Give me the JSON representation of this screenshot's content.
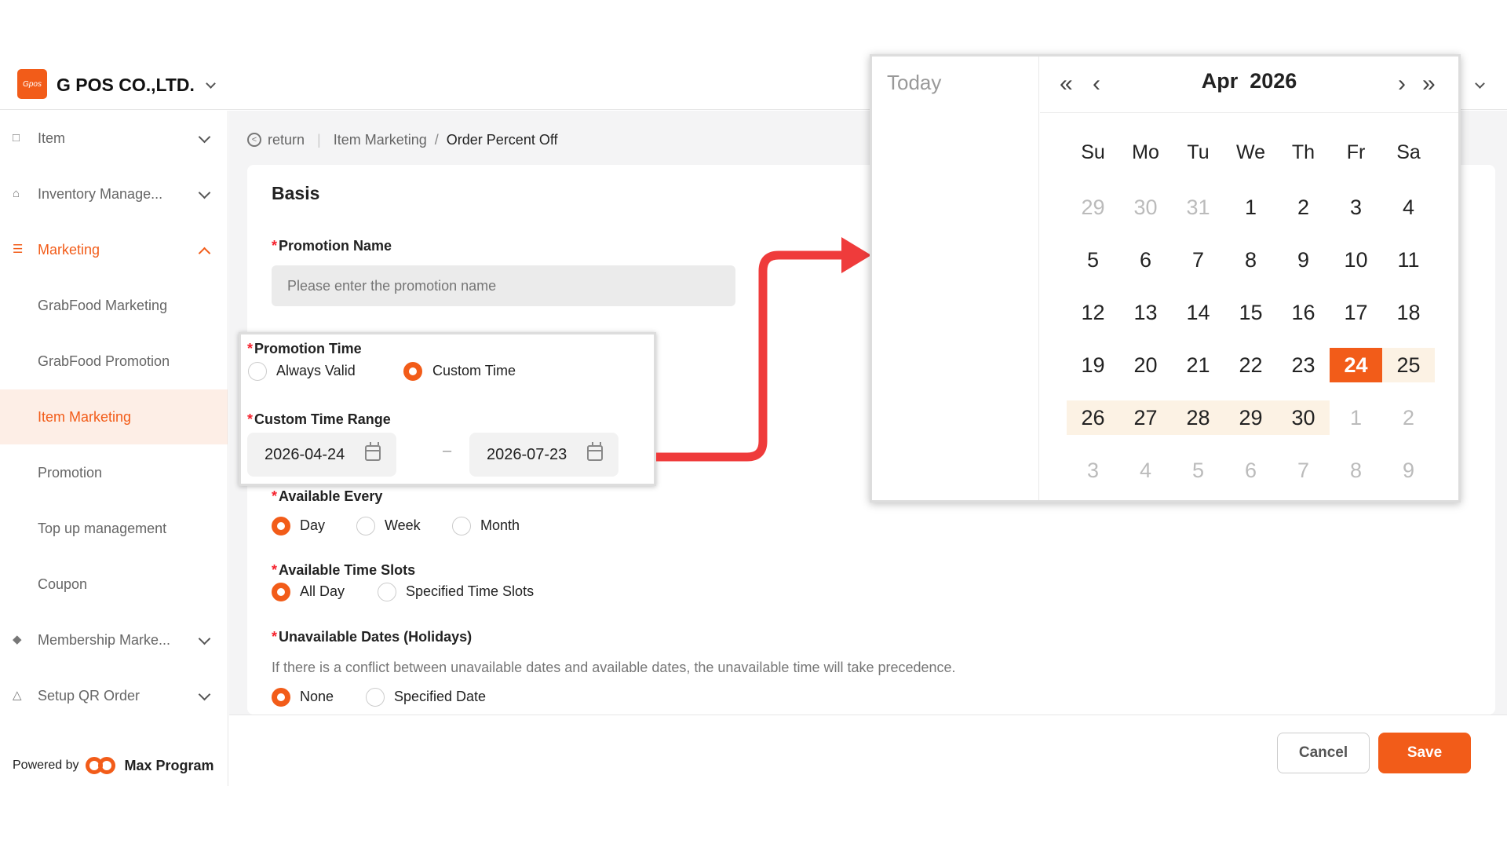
{
  "header": {
    "logo_text": "Gpos",
    "company": "G POS CO.,LTD."
  },
  "breadcrumb": {
    "return_label": "return",
    "parent": "Item Marketing",
    "separator": "/",
    "current": "Order Percent Off"
  },
  "sidebar": {
    "items": [
      {
        "label": "Item",
        "icon": "item-icon"
      },
      {
        "label": "Inventory Manage...",
        "icon": "warehouse-icon"
      },
      {
        "label": "Marketing",
        "icon": "marketing-icon"
      },
      {
        "label": "GrabFood Marketing"
      },
      {
        "label": "GrabFood Promotion"
      },
      {
        "label": "Item Marketing"
      },
      {
        "label": "Promotion"
      },
      {
        "label": "Top up management"
      },
      {
        "label": "Coupon"
      },
      {
        "label": "Membership Marke...",
        "icon": "membership-icon"
      },
      {
        "label": "Setup QR Order",
        "icon": "service-bell-icon"
      }
    ],
    "powered_by": "Powered by",
    "brand": "Max Program"
  },
  "form": {
    "section_title": "Basis",
    "promotion_name": {
      "label": "Promotion Name",
      "placeholder": "Please enter the promotion name",
      "value": ""
    },
    "promotion_time": {
      "label": "Promotion Time",
      "options": [
        "Always Valid",
        "Custom Time"
      ],
      "selected": "Custom Time"
    },
    "custom_time_range": {
      "label": "Custom Time Range",
      "start": "2026-04-24",
      "end": "2026-07-23",
      "separator": "–"
    },
    "available_every": {
      "label": "Available Every",
      "options": [
        "Day",
        "Week",
        "Month"
      ],
      "selected": "Day"
    },
    "available_time_slots": {
      "label": "Available Time Slots",
      "options": [
        "All Day",
        "Specified Time Slots"
      ],
      "selected": "All Day"
    },
    "unavailable_dates": {
      "label": "Unavailable Dates (Holidays)",
      "hint": "If there is a conflict between unavailable dates and available dates, the unavailable time will take precedence.",
      "options": [
        "None",
        "Specified Date"
      ],
      "selected": "None"
    }
  },
  "footer": {
    "cancel_label": "Cancel",
    "save_label": "Save"
  },
  "calendar": {
    "today_label": "Today",
    "month": "Apr",
    "year": "2026",
    "weekdays": [
      "Su",
      "Mo",
      "Tu",
      "We",
      "Th",
      "Fr",
      "Sa"
    ],
    "weeks": [
      [
        "29",
        "30",
        "31",
        "1",
        "2",
        "3",
        "4"
      ],
      [
        "5",
        "6",
        "7",
        "8",
        "9",
        "10",
        "11"
      ],
      [
        "12",
        "13",
        "14",
        "15",
        "16",
        "17",
        "18"
      ],
      [
        "19",
        "20",
        "21",
        "22",
        "23",
        "24",
        "25"
      ],
      [
        "26",
        "27",
        "28",
        "29",
        "30",
        "1",
        "2"
      ],
      [
        "3",
        "4",
        "5",
        "6",
        "7",
        "8",
        "9"
      ]
    ],
    "selected_day": "24"
  },
  "colors": {
    "accent": "#f25c19",
    "range_bg": "#fcf2e4",
    "arrow": "#ef3b3b"
  }
}
